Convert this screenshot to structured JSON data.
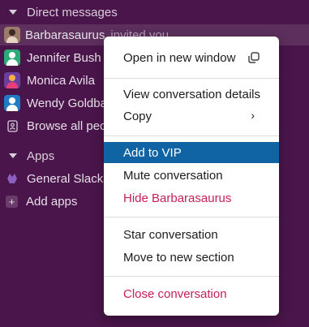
{
  "sidebar": {
    "dm_header": "Direct messages",
    "dms": [
      {
        "name": "Barbarasaurus",
        "suffix": "invited you"
      },
      {
        "name": "Jennifer Bush"
      },
      {
        "name": "Monica Avila"
      },
      {
        "name": "Wendy Goldba"
      }
    ],
    "browse_label": "Browse all peo",
    "apps_header": "Apps",
    "apps": [
      {
        "name": "General Slack I"
      }
    ],
    "add_apps_label": "Add apps"
  },
  "menu": {
    "open_window": "Open in new window",
    "view_details": "View conversation details",
    "copy": "Copy",
    "add_vip": "Add to VIP",
    "mute": "Mute conversation",
    "hide": "Hide Barbarasaurus",
    "star": "Star conversation",
    "move": "Move to new section",
    "close": "Close conversation"
  },
  "colors": {
    "sidebar_bg": "#4a154b",
    "highlight": "#1164a3",
    "danger": "#c61f56"
  }
}
